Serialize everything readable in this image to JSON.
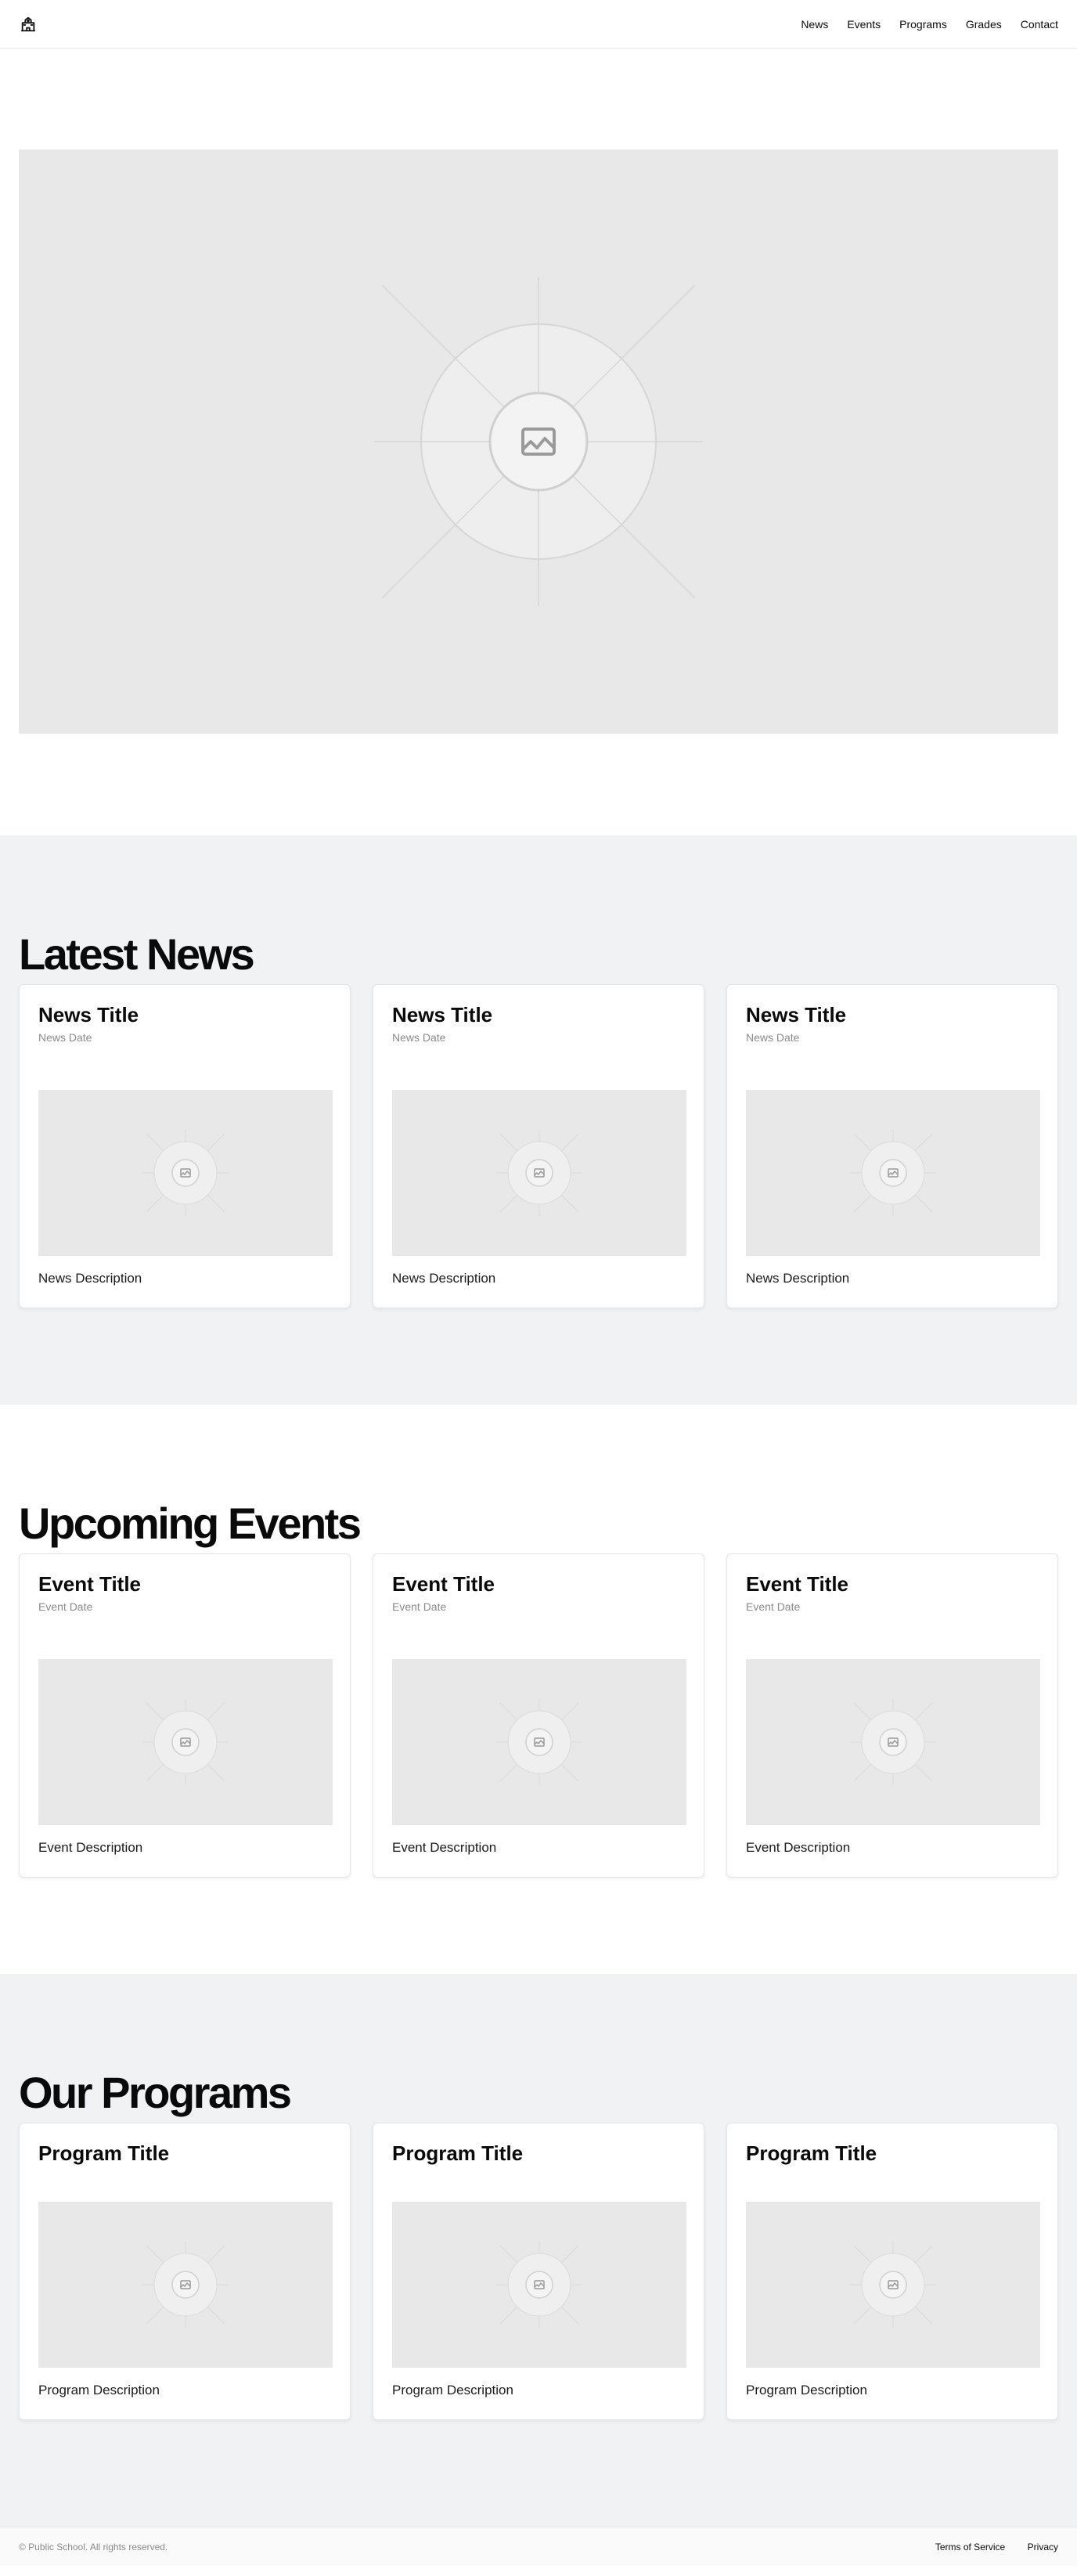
{
  "header": {
    "logo_icon": "school-building-icon",
    "nav": [
      "News",
      "Events",
      "Programs",
      "Grades",
      "Contact"
    ]
  },
  "hero": {
    "image_icon": "image-placeholder-icon"
  },
  "news": {
    "title": "Latest News",
    "cards": [
      {
        "title": "News Title",
        "date": "News Date",
        "description": "News Description"
      },
      {
        "title": "News Title",
        "date": "News Date",
        "description": "News Description"
      },
      {
        "title": "News Title",
        "date": "News Date",
        "description": "News Description"
      }
    ]
  },
  "events": {
    "title": "Upcoming Events",
    "cards": [
      {
        "title": "Event Title",
        "date": "Event Date",
        "description": "Event Description"
      },
      {
        "title": "Event Title",
        "date": "Event Date",
        "description": "Event Description"
      },
      {
        "title": "Event Title",
        "date": "Event Date",
        "description": "Event Description"
      }
    ]
  },
  "programs": {
    "title": "Our Programs",
    "cards": [
      {
        "title": "Program Title",
        "description": "Program Description"
      },
      {
        "title": "Program Title",
        "description": "Program Description"
      },
      {
        "title": "Program Title",
        "description": "Program Description"
      }
    ]
  },
  "footer": {
    "copyright": "© Public School. All rights reserved.",
    "links": [
      "Terms of Service",
      "Privacy"
    ]
  },
  "colors": {
    "section_gray": "#f1f2f4",
    "placeholder_bg": "#e8e8e8"
  }
}
